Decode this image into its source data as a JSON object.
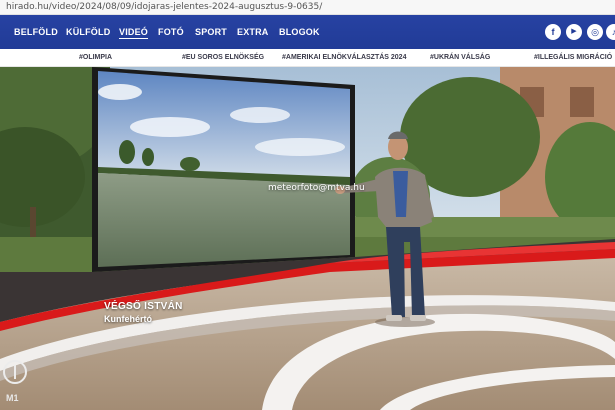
{
  "browser": {
    "url": "hirado.hu/video/2024/08/09/idojaras-jelentes-2024-augusztus-9-0635/"
  },
  "nav": {
    "items": [
      {
        "label": "BELFÖLD",
        "active": false
      },
      {
        "label": "KÜLFÖLD",
        "active": false
      },
      {
        "label": "VIDEÓ",
        "active": true
      },
      {
        "label": "FOTÓ",
        "active": false
      },
      {
        "label": "SPORT",
        "active": false
      },
      {
        "label": "EXTRA",
        "active": false
      },
      {
        "label": "BLOGOK",
        "active": false
      }
    ],
    "social": [
      {
        "icon": "facebook-icon",
        "glyph": "f"
      },
      {
        "icon": "youtube-icon",
        "glyph": "▶"
      },
      {
        "icon": "instagram-icon",
        "glyph": "◎"
      },
      {
        "icon": "tiktok-icon",
        "glyph": "♪"
      }
    ]
  },
  "topics": [
    "#OLIMPIA",
    "#EU SOROS ELNÖKSÉG",
    "#AMERIKAI ELNÖKVÁLASZTÁS 2024",
    "#UKRÁN VÁLSÁG",
    "#ILLEGÁLIS MIGRÁCIÓ"
  ],
  "video": {
    "watermark": "meteorfoto@mtva.hu",
    "caption_name": "VÉGSŐ ISTVÁN",
    "caption_place": "Kunfehértó",
    "channel_logo": "M1"
  },
  "colors": {
    "nav_bg": "#213b97",
    "studio_red": "#d91a1a"
  }
}
